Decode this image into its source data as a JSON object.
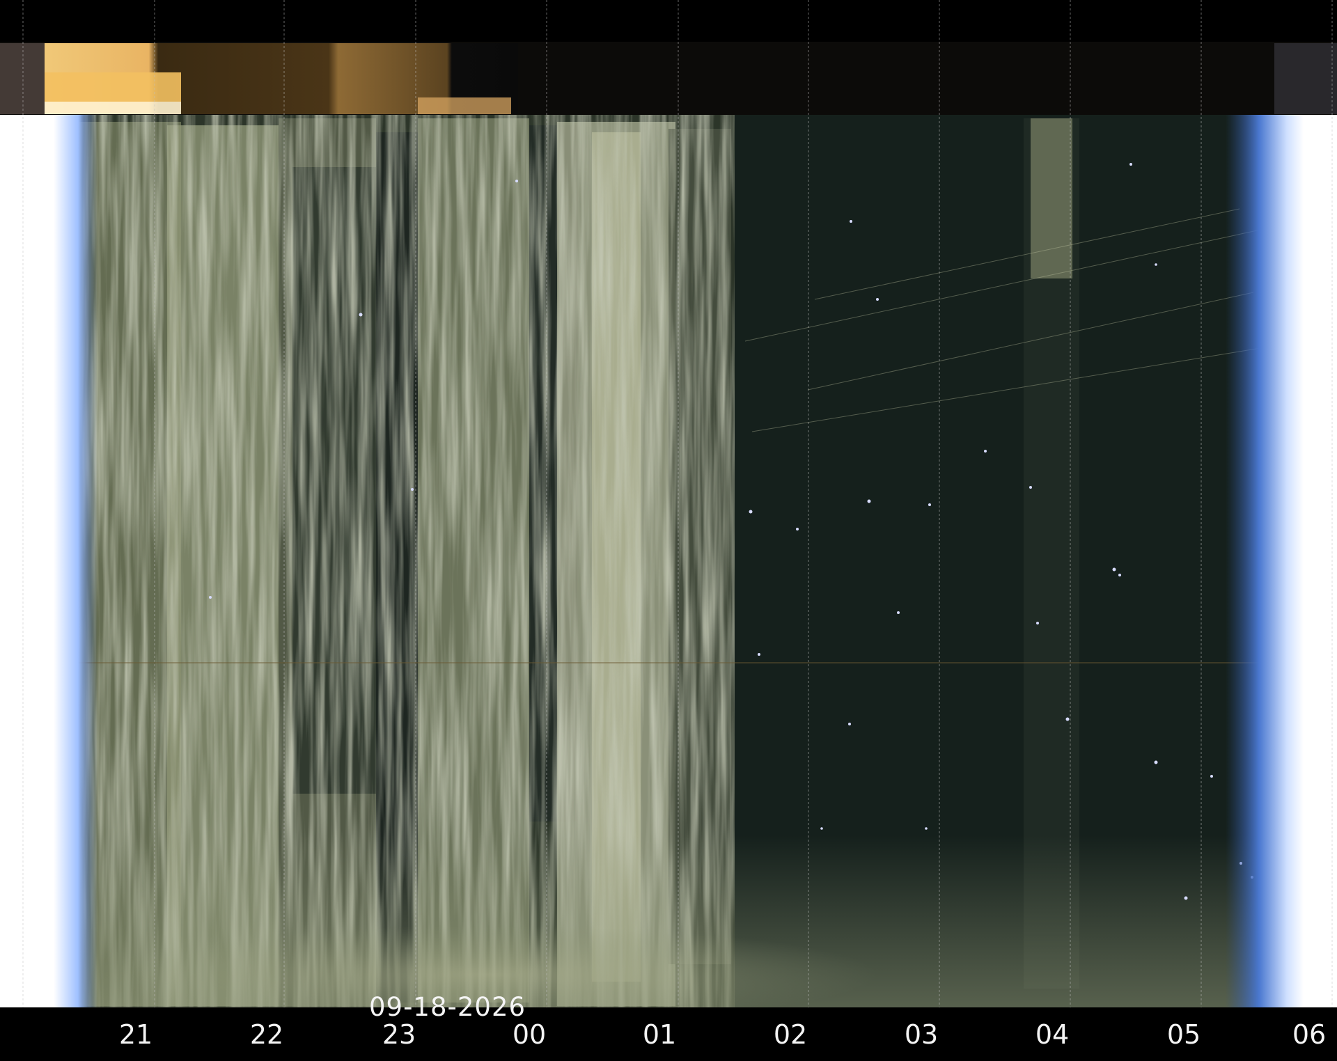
{
  "image": {
    "kind": "keogram",
    "date": "09-18-2026",
    "hour_labels": [
      "21",
      "22",
      "23",
      "00",
      "01",
      "02",
      "03",
      "04",
      "05",
      "06"
    ],
    "colors": {
      "background": "#000000",
      "sky": "#15201c",
      "cloud": "#8e9676",
      "twilight_edge": "#3a5fa8",
      "sunset_band": "#e8b060",
      "label": "#f4f4f4"
    }
  }
}
